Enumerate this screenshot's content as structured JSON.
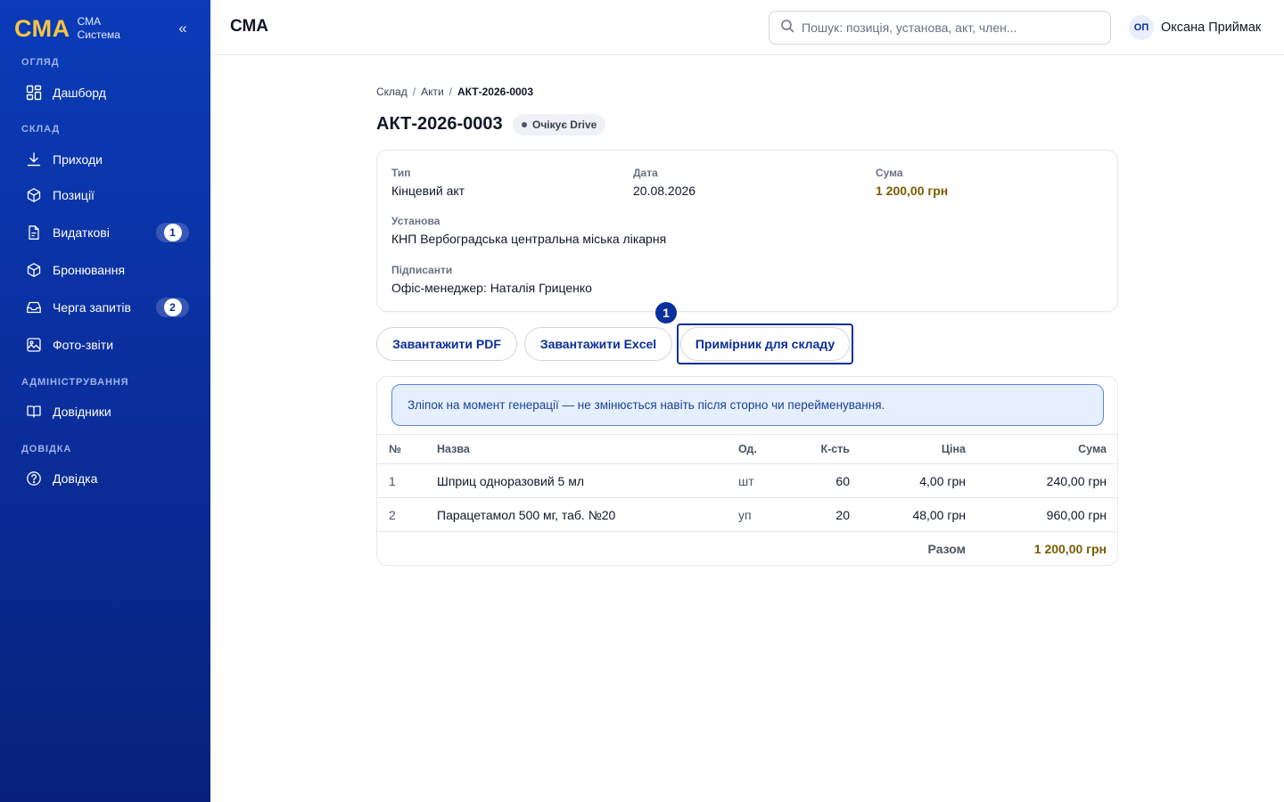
{
  "brand": {
    "logo": "СМА",
    "line1": "СМА",
    "line2": "Система",
    "collapse": "«"
  },
  "sidebar": {
    "sections": [
      {
        "title": "ОГЛЯД",
        "items": [
          {
            "label": "Дашборд",
            "icon": "dashboard-icon"
          }
        ]
      },
      {
        "title": "СКЛАД",
        "items": [
          {
            "label": "Приходи",
            "icon": "download-icon"
          },
          {
            "label": "Позиції",
            "icon": "box-icon"
          },
          {
            "label": "Видаткові",
            "icon": "document-icon",
            "badge": "1"
          },
          {
            "label": "Бронювання",
            "icon": "box-icon"
          },
          {
            "label": "Черга запитів",
            "icon": "inbox-icon",
            "badge": "2"
          },
          {
            "label": "Фото-звіти",
            "icon": "image-icon"
          }
        ]
      },
      {
        "title": "АДМІНІСТРУВАННЯ",
        "items": [
          {
            "label": "Довідники",
            "icon": "book-icon"
          }
        ]
      },
      {
        "title": "ДОВІДКА",
        "items": [
          {
            "label": "Довідка",
            "icon": "help-icon"
          }
        ]
      }
    ]
  },
  "header": {
    "title": "СМА",
    "search_placeholder": "Пошук: позиція, установа, акт, член...",
    "user": {
      "initials": "ОП",
      "name": "Оксана Приймак"
    }
  },
  "breadcrumb": {
    "items": [
      "Склад",
      "Акти"
    ],
    "current": "АКТ-2026-0003",
    "separator": "/"
  },
  "page": {
    "title": "АКТ-2026-0003",
    "status": "Очікує Drive"
  },
  "details": {
    "type_label": "Тип",
    "type_value": "Кінцевий акт",
    "date_label": "Дата",
    "date_value": "20.08.2026",
    "sum_label": "Сума",
    "sum_value": "1 200,00 грн",
    "institution_label": "Установа",
    "institution_value": "КНП Вербоградська центральна міська лікарня",
    "signers_label": "Підписанти",
    "signers_value": "Офіс-менеджер: Наталія Гриценко"
  },
  "actions": {
    "pdf": "Завантажити PDF",
    "excel": "Завантажити Excel",
    "copy": "Примірник для складу",
    "marker": "1"
  },
  "notice": "Зліпок на момент генерації — не змінюється навіть після сторно чи перейменування.",
  "table": {
    "headers": {
      "num": "№",
      "name": "Назва",
      "unit": "Од.",
      "qty": "К-сть",
      "price": "Ціна",
      "sum": "Сума"
    },
    "rows": [
      {
        "num": "1",
        "name": "Шприц одноразовий 5 мл",
        "unit": "шт",
        "qty": "60",
        "price": "4,00 грн",
        "sum": "240,00 грн"
      },
      {
        "num": "2",
        "name": "Парацетамол 500 мг, таб. №20",
        "unit": "уп",
        "qty": "20",
        "price": "48,00 грн",
        "sum": "960,00 грн"
      }
    ],
    "total_label": "Разом",
    "total_value": "1 200,00 грн"
  },
  "colors": {
    "sidebar": "#0a2e9c",
    "brand_logo": "#f5c542",
    "accent": "#0a2e9c",
    "money": "#7a5b00",
    "notice_bg": "#e5efff"
  }
}
